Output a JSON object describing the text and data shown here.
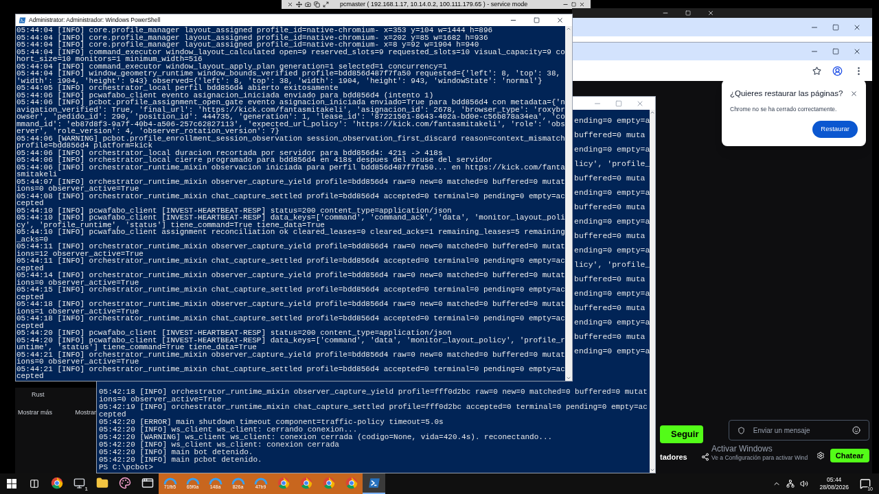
{
  "remote_bar": {
    "title": "pcmaster ( 192.168.1.17, 10.14.0.2, 100.111.179.65 ) - service mode"
  },
  "main_terminal": {
    "title": "Administrator: Administrador: Windows PowerShell",
    "lines": [
      "05:44:04 [INFO] core.profile_manager layout_assigned profile_id=native-chromium- x=353 y=104 w=1444 h=896",
      "05:44:04 [INFO] core.profile_manager layout_assigned profile_id=native-chromium- x=202 y=85 w=1682 h=936",
      "05:44:04 [INFO] core.profile_manager layout_assigned profile_id=native-chromium- x=8 y=92 w=1904 h=940",
      "05:44:04 [INFO] command_executor window_layout_calculated open=9 reserved_slots=9 requested_slots=10 visual_capacity=9 cohort_size=10 monitors=1 minimum_width=516",
      "05:44:04 [INFO] command_executor window_layout_apply_plan generation=1 selected=1 concurrency=1",
      "05:44:04 [INFO] window_geometry_runtime window_bounds_verified profile=bdd856d487f7fa50 requested={'left': 8, 'top': 38, 'width': 1904, 'height': 943} observed={'left': 8, 'top': 38, 'width': 1904, 'height': 943, 'windowState': 'normal'}",
      "05:44:05 [INFO] orchestrator_local perfil bdd856d4 abierto exitosamente",
      "05:44:06 [INFO] pcwafabo_client evento asignacion_iniciada enviado para bdd856d4 (intento 1)",
      "05:44:06 [INFO] pcbot.profile_assignment_open_gate evento asignacion_iniciada enviado=True para bdd856d4 con metadata={'navigation_verified': True, 'final_url': 'https://kick.com/fantasmitakeli', 'asignacion_id': 2678, 'browser_type': 'roxybrowser', 'pedido_id': 290, 'position_id': 444735, 'generation': 1, 'lease_id': '87221501-8643-402a-bd0e-c56b878a34ea', 'command_id': 'eb87d8f3-9a7f-40b4-a506-257c62827113', 'expected_url_policy': 'https://kick.com/fantasmitakeli', 'role': 'observer', 'role_version': 4, 'observer_rotation_version': 7}",
      "05:44:06 [WARNING] pcbot.profile_enrollment_session_observation session_observation_first_discard reason=context_mismatch profile=bdd856d4 platform=kick",
      "05:44:06 [INFO] orchestrator_local duracion recortada por servidor para bdd856d4: 421s -> 418s",
      "05:44:06 [INFO] orchestrator_local cierre programado para bdd856d4 en 418s despues del acuse del servidor",
      "05:44:06 [INFO] orchestrator_runtime_mixin observacion iniciada para perfil bdd856d487f7fa50... en https://kick.com/fantasmitakeli",
      "05:44:07 [INFO] orchestrator_runtime_mixin observer_capture_yield profile=bdd856d4 raw=0 new=0 matched=0 buffered=0 mutations=0 observer_active=True",
      "05:44:08 [INFO] orchestrator_runtime_mixin chat_capture_settled profile=bdd856d4 accepted=0 terminal=0 pending=0 empty=accepted",
      "05:44:10 [INFO] pcwafabo_client [INVEST-HEARTBEAT-RESP] status=200 content_type=application/json",
      "05:44:10 [INFO] pcwafabo_client [INVEST-HEARTBEAT-RESP] data_keys=['command', 'command_ack', 'data', 'monitor_layout_policy', 'profile_runtime', 'status'] tiene_command=True tiene_data=True",
      "05:44:10 [INFO] pcwafabo_client assignment reconciliation ok cleared_leases=0 cleared_acks=1 remaining_leases=5 remaining_acks=0",
      "05:44:11 [INFO] orchestrator_runtime_mixin observer_capture_yield profile=bdd856d4 raw=0 new=0 matched=0 buffered=0 mutations=12 observer_active=True",
      "05:44:11 [INFO] orchestrator_runtime_mixin chat_capture_settled profile=bdd856d4 accepted=0 terminal=0 pending=0 empty=accepted",
      "05:44:14 [INFO] orchestrator_runtime_mixin observer_capture_yield profile=bdd856d4 raw=0 new=0 matched=0 buffered=0 mutations=0 observer_active=True",
      "05:44:15 [INFO] orchestrator_runtime_mixin chat_capture_settled profile=bdd856d4 accepted=0 terminal=0 pending=0 empty=accepted",
      "05:44:18 [INFO] orchestrator_runtime_mixin observer_capture_yield profile=bdd856d4 raw=0 new=0 matched=0 buffered=0 mutations=1 observer_active=True",
      "05:44:18 [INFO] orchestrator_runtime_mixin chat_capture_settled profile=bdd856d4 accepted=0 terminal=0 pending=0 empty=accepted",
      "05:44:20 [INFO] pcwafabo_client [INVEST-HEARTBEAT-RESP] status=200 content_type=application/json",
      "05:44:20 [INFO] pcwafabo_client [INVEST-HEARTBEAT-RESP] data_keys=['command', 'data', 'monitor_layout_policy', 'profile_runtime', 'status'] tiene_command=True tiene_data=True",
      "05:44:21 [INFO] orchestrator_runtime_mixin observer_capture_yield profile=bdd856d4 raw=0 new=0 matched=0 buffered=0 mutations=0 observer_active=True",
      "05:44:21 [INFO] orchestrator_runtime_mixin chat_capture_settled profile=bdd856d4 accepted=0 terminal=0 pending=0 empty=accepted"
    ]
  },
  "background_terminal": {
    "fragments": [
      "ending=0 empty=a",
      "buffered=0 muta",
      "ending=0 empty=a",
      "licy', 'profile_",
      "buffered=0 muta",
      "ending=0 empty=a",
      "buffered=0 muta",
      "ending=0 empty=a",
      "buffered=0 muta",
      "ending=0 empty=a",
      "licy', 'profile_",
      "buffered=0 muta",
      "ending=0 empty=a",
      "buffered=0 muta",
      "ending=0 empty=a",
      "buffered=0 muta",
      "ending=0 empty=a"
    ],
    "lines": [
      "05:42:18 [INFO] orchestrator_runtime_mixin observer_capture_yield profile=fff0d2bc raw=0 new=0 matched=0 buffered=0 mutations=0 observer_active=True",
      "05:42:19 [INFO] orchestrator_runtime_mixin chat_capture_settled profile=fff0d2bc accepted=0 terminal=0 pending=0 empty=accepted",
      "05:42:20 [ERROR] main shutdown timeout component=traffic-policy timeout=5.0s",
      "05:42:20 [INFO] ws_client ws_client: cerrando conexion...",
      "05:42:20 [WARNING] ws_client ws_client: conexion cerrada (codigo=None, vida=420.4s). reconectando...",
      "05:42:20 [INFO] ws_client ws_client: conexion cerrada",
      "05:42:20 [INFO] main bot detenido.",
      "05:42:20 [INFO] main pcbot detenido."
    ],
    "prompt": "PS C:\\pcbot>"
  },
  "side_panel": {
    "items": [
      "Rust",
      "Mostrar más",
      "Mostrar"
    ]
  },
  "restore_popup": {
    "title": "¿Quieres restaurar las páginas?",
    "message": "Chrome no se ha cerrado correctamente.",
    "button": "Restaurar"
  },
  "stream": {
    "follow_button": "Seguir",
    "tab_fragment": "tadores",
    "chat_placeholder": "Enviar un mensaje",
    "chat_button": "Chatear"
  },
  "activation_notice": {
    "title": "Activar Windows",
    "message": "Ve a Configuración para activar Wind"
  },
  "taskbar": {
    "apps": [
      {
        "kind": "chrome",
        "selected": false,
        "flashing": false
      },
      {
        "kind": "monitor",
        "badge": "1",
        "selected": false,
        "flashing": false
      },
      {
        "kind": "folder",
        "selected": false,
        "flashing": false
      },
      {
        "kind": "paint",
        "selected": false,
        "flashing": false
      },
      {
        "kind": "window",
        "selected": false,
        "flashing": false
      },
      {
        "kind": "bot",
        "label": "71fb5",
        "selected": false,
        "flashing": true
      },
      {
        "kind": "bot",
        "label": "65f0a",
        "selected": false,
        "flashing": true
      },
      {
        "kind": "bot",
        "label": "148a",
        "selected": false,
        "flashing": true
      },
      {
        "kind": "bot",
        "label": "826a",
        "selected": false,
        "flashing": true
      },
      {
        "kind": "bot",
        "label": "47b9",
        "selected": false,
        "flashing": true
      },
      {
        "kind": "chrome",
        "selected": false,
        "flashing": true
      },
      {
        "kind": "chrome",
        "selected": false,
        "flashing": true
      },
      {
        "kind": "chrome",
        "selected": false,
        "flashing": true
      },
      {
        "kind": "chrome",
        "selected": false,
        "flashing": true
      },
      {
        "kind": "powershell",
        "selected": true,
        "flashing": false
      }
    ],
    "time": "05:44",
    "date": "28/08/2026",
    "notifications": "10"
  }
}
